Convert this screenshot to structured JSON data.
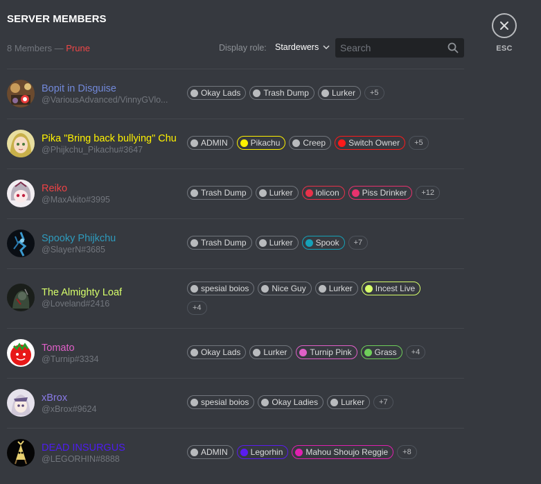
{
  "header": {
    "title": "SERVER MEMBERS",
    "member_count": "8 Members",
    "separator": " — ",
    "prune_label": "Prune",
    "display_role_label": "Display role:",
    "display_role_value": "Stardewers",
    "search_placeholder": "Search",
    "esc_label": "ESC"
  },
  "colors": {
    "background": "#36393f",
    "muted": "#72767d",
    "prune": "#f04747",
    "default_role": "#b9bbbe"
  },
  "members": [
    {
      "name": "Bopit in Disguise",
      "name_color": "#7289da",
      "tag": "@VariousAdvanced/VinnyGVlo...",
      "roles": [
        {
          "label": "Okay Lads",
          "color": "#b9bbbe"
        },
        {
          "label": "Trash Dump",
          "color": "#b9bbbe"
        },
        {
          "label": "Lurker",
          "color": "#b9bbbe"
        }
      ],
      "more": "+5"
    },
    {
      "name": "Pika \"Bring back bullying\" Chu",
      "name_color": "#fff200",
      "tag": "@Phijkchu_Pikachu#3647",
      "roles": [
        {
          "label": "ADMIN",
          "color": "#b9bbbe"
        },
        {
          "label": "Pikachu",
          "color": "#fff200"
        },
        {
          "label": "Creep",
          "color": "#b9bbbe"
        },
        {
          "label": "Switch Owner",
          "color": "#ff1a1a"
        }
      ],
      "more": "+5"
    },
    {
      "name": "Reiko",
      "name_color": "#ed4245",
      "tag": "@MaxAkito#3995",
      "roles": [
        {
          "label": "Trash Dump",
          "color": "#b9bbbe"
        },
        {
          "label": "Lurker",
          "color": "#b9bbbe"
        },
        {
          "label": "lolicon",
          "color": "#e8324a"
        },
        {
          "label": "Piss Drinker",
          "color": "#e8326e"
        }
      ],
      "more": "+12"
    },
    {
      "name": "Spooky Phijkchu",
      "name_color": "#2e9bbd",
      "tag": "@SlayerN#3685",
      "roles": [
        {
          "label": "Trash Dump",
          "color": "#b9bbbe"
        },
        {
          "label": "Lurker",
          "color": "#b9bbbe"
        },
        {
          "label": "Spook",
          "color": "#16a2b8"
        }
      ],
      "more": "+7"
    },
    {
      "name": "The Almighty Loaf",
      "name_color": "#d7ff6b",
      "tag": "@Loveland#2416",
      "roles": [
        {
          "label": "spesial boios",
          "color": "#b9bbbe"
        },
        {
          "label": "Nice Guy",
          "color": "#b9bbbe"
        },
        {
          "label": "Lurker",
          "color": "#b9bbbe"
        },
        {
          "label": "Incest Live",
          "color": "#d7ff6b"
        }
      ],
      "more": "+4"
    },
    {
      "name": "Tomato",
      "name_color": "#e060c8",
      "tag": "@Turnip#3334",
      "roles": [
        {
          "label": "Okay Lads",
          "color": "#b9bbbe"
        },
        {
          "label": "Lurker",
          "color": "#b9bbbe"
        },
        {
          "label": "Turnip Pink",
          "color": "#e060c8"
        },
        {
          "label": "Grass",
          "color": "#6fcf5a"
        }
      ],
      "more": "+4"
    },
    {
      "name": "xBrox",
      "name_color": "#8a7be8",
      "tag": "@xBrox#9624",
      "roles": [
        {
          "label": "spesial boios",
          "color": "#b9bbbe"
        },
        {
          "label": "Okay Ladies",
          "color": "#b9bbbe"
        },
        {
          "label": "Lurker",
          "color": "#b9bbbe"
        }
      ],
      "more": "+7"
    },
    {
      "name": "DEAD INSURGUS",
      "name_color": "#4d1cf0",
      "tag": "@LEGORHIN#8888",
      "roles": [
        {
          "label": "ADMIN",
          "color": "#b9bbbe"
        },
        {
          "label": "Legorhin",
          "color": "#5a1cf0"
        },
        {
          "label": "Mahou Shoujo Reggie",
          "color": "#e020b0"
        }
      ],
      "more": "+8"
    }
  ]
}
